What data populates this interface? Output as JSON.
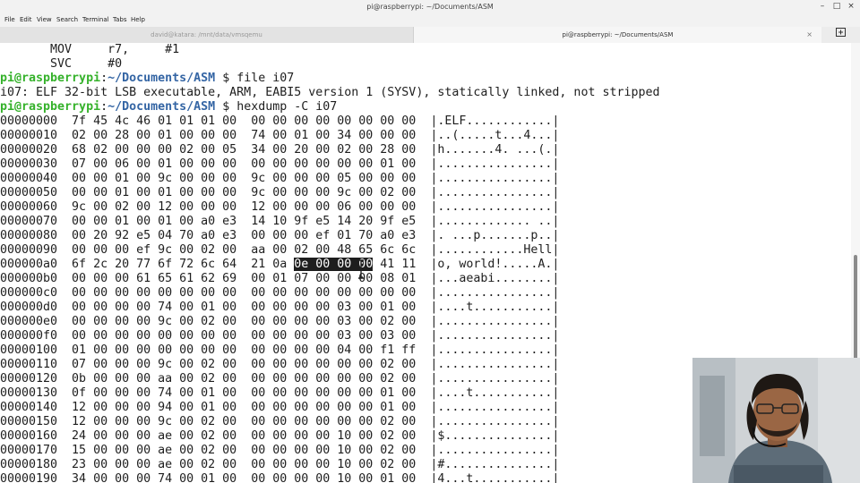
{
  "window": {
    "title": "pi@raspberrypi: ~/Documents/ASM",
    "controls": [
      "–",
      "□",
      "×"
    ]
  },
  "menu": [
    "File",
    "Edit",
    "View",
    "Search",
    "Terminal",
    "Tabs",
    "Help"
  ],
  "tabs": [
    {
      "label": "david@katara: /mnt/data/vmsqemu",
      "active": false
    },
    {
      "label": "pi@raspberrypi: ~/Documents/ASM",
      "active": true,
      "close": "×"
    }
  ],
  "new_tab_icon": "new-tab-icon",
  "terminal": {
    "pre_lines": [
      "       MOV     r7,     #1",
      "       SVC     #0"
    ],
    "prompt_user": "pi@raspberrypi",
    "prompt_sep": ":",
    "prompt_path": "~/Documents/ASM",
    "prompt_end": " $ ",
    "cmd1": "file i07",
    "file_output": "i07: ELF 32-bit LSB executable, ARM, EABI5 version 1 (SYSV), statically linked, not stripped",
    "cmd2": "hexdump -C i07",
    "dump_before": [
      "00000000  7f 45 4c 46 01 01 01 00  00 00 00 00 00 00 00 00  |.ELF............|",
      "00000010  02 00 28 00 01 00 00 00  74 00 01 00 34 00 00 00  |..(.....t...4...|",
      "00000020  68 02 00 00 00 02 00 05  34 00 20 00 02 00 28 00  |h.......4. ...(.|",
      "00000030  07 00 06 00 01 00 00 00  00 00 00 00 00 00 01 00  |................|",
      "00000040  00 00 01 00 9c 00 00 00  9c 00 00 00 05 00 00 00  |................|",
      "00000050  00 00 01 00 01 00 00 00  9c 00 00 00 9c 00 02 00  |................|",
      "00000060  9c 00 02 00 12 00 00 00  12 00 00 00 06 00 00 00  |................|",
      "00000070  00 00 01 00 01 00 a0 e3  14 10 9f e5 14 20 9f e5  |............. ..|",
      "00000080  00 20 92 e5 04 70 a0 e3  00 00 00 ef 01 70 a0 e3  |. ...p.......p..|",
      "00000090  00 00 00 ef 9c 00 02 00  aa 00 02 00 48 65 6c 6c  |............Hell|"
    ],
    "hl_pre": "000000a0  6f 2c 20 77 6f 72 6c 64  21 0a ",
    "hl_sel": "0e 00 00 00",
    "hl_post": " 41 11  |o, world!.....A.|",
    "dump_after": [
      "000000b0  00 00 00 61 65 61 62 69  00 01 07 00 00 00 08 01  |...aeabi........|",
      "000000c0  00 00 00 00 00 00 00 00  00 00 00 00 00 00 00 00  |................|",
      "000000d0  00 00 00 00 74 00 01 00  00 00 00 00 03 00 01 00  |....t...........|",
      "000000e0  00 00 00 00 9c 00 02 00  00 00 00 00 03 00 02 00  |................|",
      "000000f0  00 00 00 00 00 00 00 00  00 00 00 00 03 00 03 00  |................|",
      "00000100  01 00 00 00 00 00 00 00  00 00 00 00 04 00 f1 ff  |................|",
      "00000110  07 00 00 00 9c 00 02 00  00 00 00 00 00 00 02 00  |................|",
      "00000120  0b 00 00 00 aa 00 02 00  00 00 00 00 00 00 02 00  |................|",
      "00000130  0f 00 00 00 74 00 01 00  00 00 00 00 00 00 01 00  |....t...........|",
      "00000140  12 00 00 00 94 00 01 00  00 00 00 00 00 00 01 00  |................|",
      "00000150  12 00 00 00 9c 00 02 00  00 00 00 00 00 00 02 00  |................|",
      "00000160  24 00 00 00 ae 00 02 00  00 00 00 00 10 00 02 00  |$...............|",
      "00000170  15 00 00 00 ae 00 02 00  00 00 00 00 10 00 02 00  |................|",
      "00000180  23 00 00 00 ae 00 02 00  00 00 00 00 10 00 02 00  |#...............|",
      "00000190  34 00 00 00 74 00 01 00  00 00 00 00 10 00 01 00  |4...t...........|"
    ]
  },
  "colors": {
    "prompt_user": "#35b22b",
    "prompt_path": "#3465a4",
    "terminal_bg": "#ffffff",
    "terminal_fg": "#1e1e1e"
  }
}
